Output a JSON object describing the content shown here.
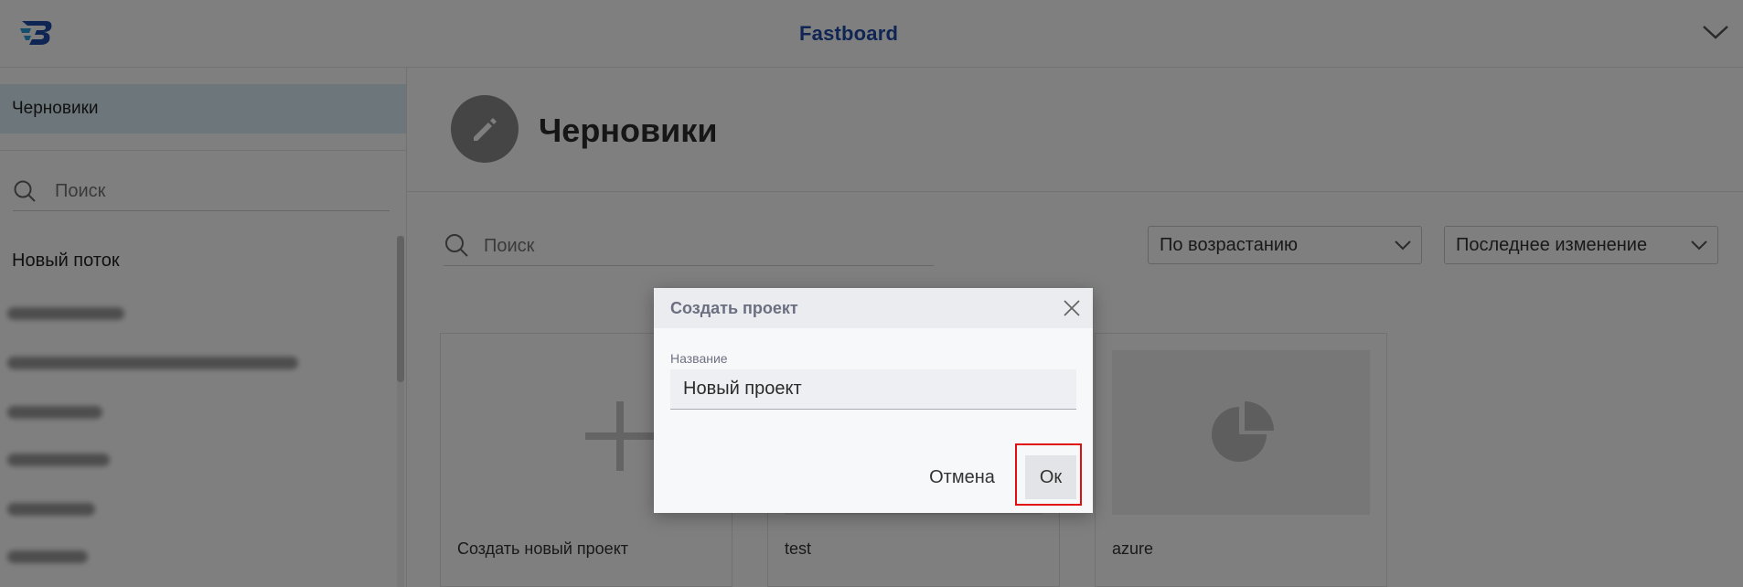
{
  "header": {
    "brand": "Fastboard",
    "logo_icon": "fastboard-logo-icon",
    "menu_icon": "chevron-down-icon"
  },
  "sidebar": {
    "active_item": "Черновики",
    "search_placeholder": "Поиск",
    "flow_label": "Новый поток",
    "blurred_items_count": 6
  },
  "main": {
    "page_icon": "pencil-icon",
    "page_title": "Черновики",
    "search_placeholder": "Поиск",
    "sort_order": "По возрастанию",
    "sort_field": "Последнее изменение",
    "cards": [
      {
        "caption": "Создать новый проект",
        "icon": "plus-icon"
      },
      {
        "caption": "test",
        "icon": ""
      },
      {
        "caption": "azure",
        "icon": "pie-chart-icon"
      }
    ]
  },
  "dialog": {
    "title": "Создать проект",
    "name_label": "Название",
    "name_value": "Новый проект",
    "cancel_label": "Отмена",
    "ok_label": "Ок"
  },
  "colors": {
    "brand": "#1f4aa8",
    "highlight": "#e01010",
    "sidebar_active": "#d9ecf7"
  }
}
